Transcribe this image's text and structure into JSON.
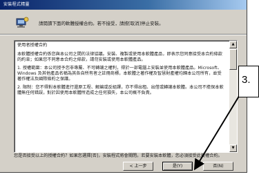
{
  "window": {
    "title": "安裝程式精靈"
  },
  "header": {
    "icon": "setup-wizard-icon",
    "instruction": "請閱讀下面的軟體授權合約。若不接受，請按[取消]停止安裝。"
  },
  "license": {
    "paragraphs": [
      "使用者授權合約",
      "本軟體授權合約係您與本公司之間的法律協議。安裝、複製或使用本軟體產品，即表示您同意接受本合約條款的約束；如果您不同意本合約之條款，請勿安裝或使用本軟體產品。",
      "1. 授權範圍：本公司授予您非專屬、不可轉讓之權利，得於一部電腦上安裝並使用本軟體產品。Microsoft、Windows 及其他產品名稱為其各自所有者之註冊商標，本軟體之著作權及智慧財產權均歸本公司所有，並受著作權法及國際條約之保護。",
      "2. 限制：您不得對本軟體進行還原工程、解編或反組譯，亦不得出租、出借或轉讓本軟體。本公司不擔保本軟體無任何錯誤，對於因使用本軟體所造成之任何損失，本公司概不負責。"
    ],
    "question": "您是否接受以上的授權合約？如果您選擇[否]，安裝程式將會關閉。若要安裝本軟體，您必須接受此授權合約。"
  },
  "buttons": {
    "back": "< 上一步",
    "yes": "是(Y)",
    "no": "否(N)"
  },
  "annotation": {
    "label": "3."
  }
}
